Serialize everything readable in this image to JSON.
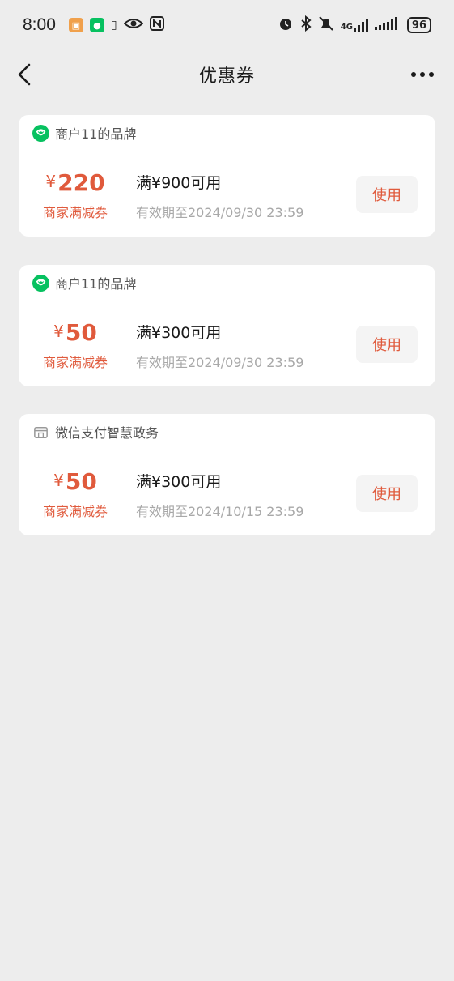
{
  "status_bar": {
    "time": "8:00",
    "battery": "96",
    "network": "4G"
  },
  "nav": {
    "title": "优惠券"
  },
  "coupons": [
    {
      "brand": "商户11的品牌",
      "brand_icon": "wechat-pay-icon",
      "currency": "¥",
      "amount": "220",
      "type": "商家满减券",
      "condition": "满¥900可用",
      "validity": "有效期至2024/09/30 23:59",
      "button": "使用"
    },
    {
      "brand": "商户11的品牌",
      "brand_icon": "wechat-pay-icon",
      "currency": "¥",
      "amount": "50",
      "type": "商家满减券",
      "condition": "满¥300可用",
      "validity": "有效期至2024/09/30 23:59",
      "button": "使用"
    },
    {
      "brand": "微信支付智慧政务",
      "brand_icon": "store-icon",
      "currency": "¥",
      "amount": "50",
      "type": "商家满减券",
      "condition": "满¥300可用",
      "validity": "有效期至2024/10/15 23:59",
      "button": "使用"
    }
  ],
  "colors": {
    "accent": "#e05a3c",
    "background": "#ededed",
    "brand_green": "#07c160"
  }
}
